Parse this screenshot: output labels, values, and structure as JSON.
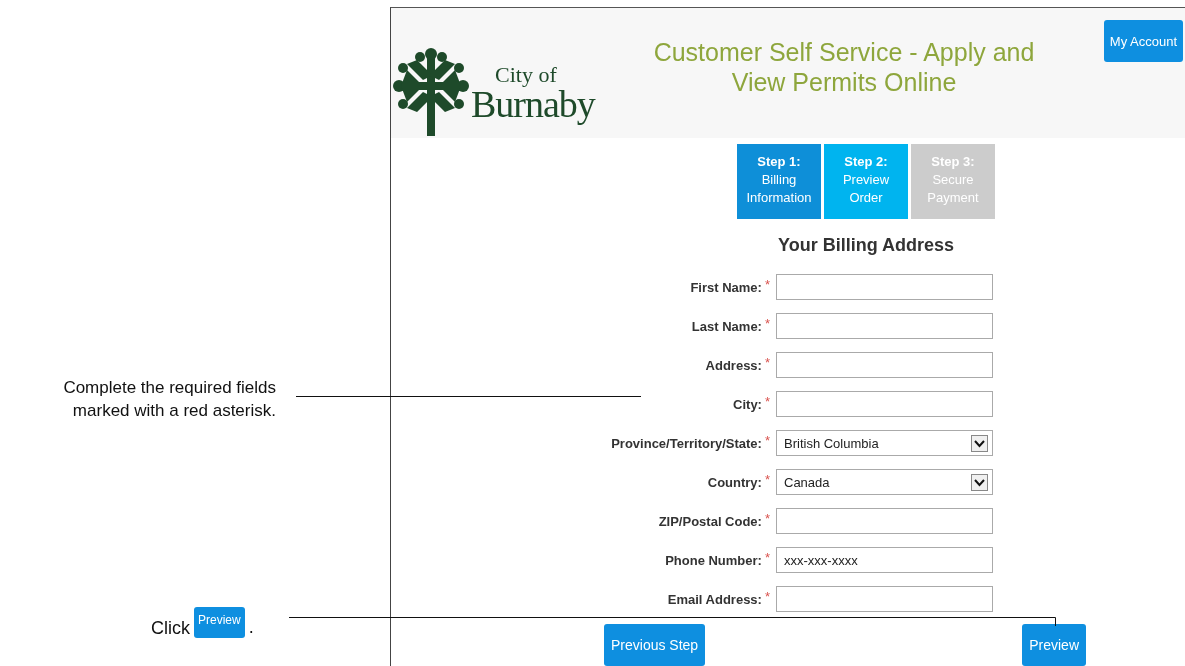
{
  "annotations": [
    {
      "kind": "note",
      "text": "Complete the required fields marked with a red asterisk."
    },
    {
      "kind": "click",
      "before": "Click",
      "button": "Preview",
      "after": "."
    }
  ],
  "header": {
    "logo_line1": "City of",
    "logo_line2": "Burnaby",
    "title": "Customer Self Service - Apply and View Permits Online",
    "account_button": "My Account"
  },
  "steps": [
    {
      "step": "Step 1:",
      "label": "Billing Information",
      "color": "#0e8fd8"
    },
    {
      "step": "Step 2:",
      "label": "Preview Order",
      "color": "#00b4ef"
    },
    {
      "step": "Step 3:",
      "label": "Secure Payment",
      "color": "#cccccc"
    }
  ],
  "form": {
    "heading": "Your Billing Address",
    "fields": [
      {
        "label": "First Name:",
        "required": true,
        "kind": "text"
      },
      {
        "label": "Last Name:",
        "required": true,
        "kind": "text"
      },
      {
        "label": "Address:",
        "required": true,
        "kind": "text"
      },
      {
        "label": "City:",
        "required": true,
        "kind": "text"
      },
      {
        "label": "Province/Territory/State:",
        "required": true,
        "kind": "select",
        "value": "British Columbia"
      },
      {
        "label": "Country:",
        "required": true,
        "kind": "select",
        "value": "Canada"
      },
      {
        "label": "ZIP/Postal Code:",
        "required": true,
        "kind": "text"
      },
      {
        "label": "Phone Number:",
        "required": true,
        "kind": "text",
        "value": "xxx-xxx-xxxx"
      },
      {
        "label": "Email Address:",
        "required": true,
        "kind": "text"
      }
    ]
  },
  "required_mark": "*",
  "buttons": [
    "Previous Step",
    "Preview"
  ]
}
